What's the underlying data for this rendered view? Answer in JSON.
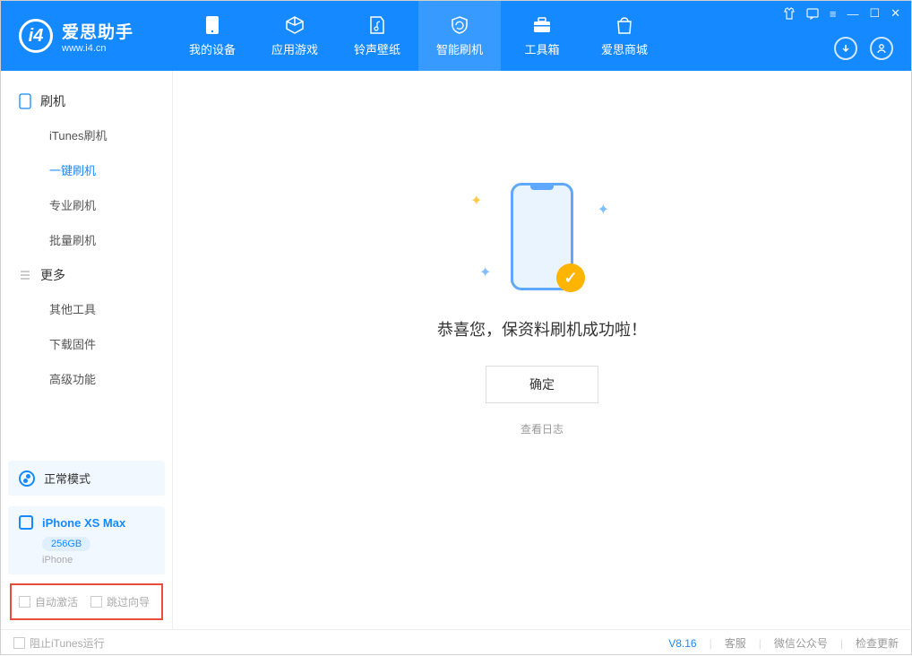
{
  "app": {
    "name": "爱思助手",
    "url": "www.i4.cn"
  },
  "nav": {
    "tabs": [
      {
        "label": "我的设备"
      },
      {
        "label": "应用游戏"
      },
      {
        "label": "铃声壁纸"
      },
      {
        "label": "智能刷机"
      },
      {
        "label": "工具箱"
      },
      {
        "label": "爱思商城"
      }
    ]
  },
  "sidebar": {
    "group1": {
      "title": "刷机",
      "items": [
        "iTunes刷机",
        "一键刷机",
        "专业刷机",
        "批量刷机"
      ]
    },
    "group2": {
      "title": "更多",
      "items": [
        "其他工具",
        "下载固件",
        "高级功能"
      ]
    }
  },
  "device": {
    "mode": "正常模式",
    "name": "iPhone XS Max",
    "storage": "256GB",
    "type": "iPhone"
  },
  "checkboxes": {
    "auto_activate": "自动激活",
    "skip_guide": "跳过向导"
  },
  "main": {
    "message": "恭喜您，保资料刷机成功啦！",
    "confirm": "确定",
    "view_log": "查看日志"
  },
  "footer": {
    "block_itunes": "阻止iTunes运行",
    "version": "V8.16",
    "support": "客服",
    "wechat": "微信公众号",
    "check_update": "检查更新"
  }
}
